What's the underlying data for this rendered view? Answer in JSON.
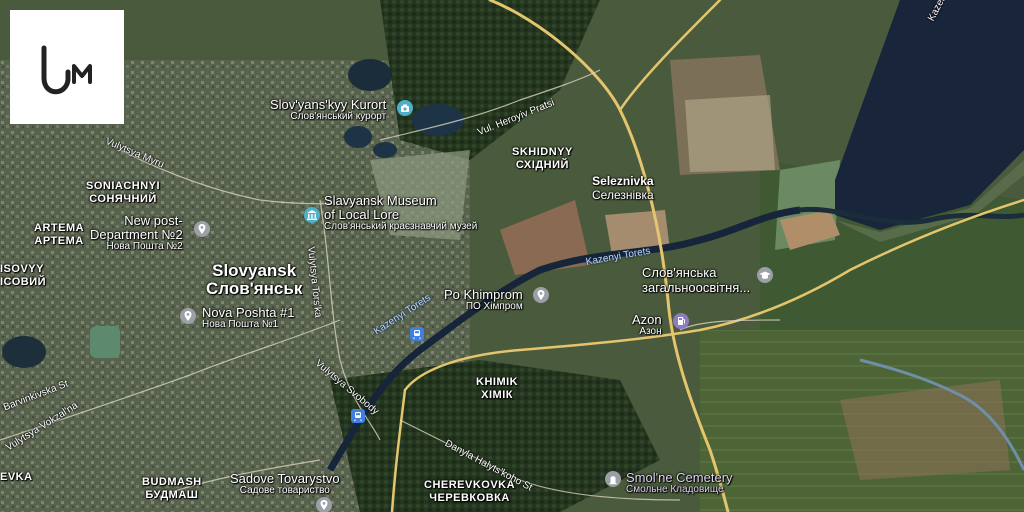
{
  "logo": {
    "glyph": "Um"
  },
  "colors": {
    "road": "#e4c56e",
    "water": "#18253a",
    "pin_gray": "#9aa0a6",
    "pin_blue": "#4db0c9",
    "pin_purple": "#8e7cc3"
  },
  "districts": {
    "soniachnyi": {
      "lat": "SONIACHNYI",
      "cyr": "СОНЯЧНИЙ"
    },
    "artema": {
      "lat": "ARTEMA",
      "cyr": "АРТЕМА"
    },
    "lisovyy": {
      "lat": "ISOVYY",
      "cyr": "ІСОВИЙ"
    },
    "skhidnyy": {
      "lat": "SKHIDNYY",
      "cyr": "СХІДНИЙ"
    },
    "khimik": {
      "lat": "KHIMIK",
      "cyr": "ХІМІК"
    },
    "cherevkovka": {
      "lat": "CHEREVKOVKA",
      "cyr": "ЧЕРЕВКОВКА"
    },
    "budmash": {
      "lat": "BUDMASH",
      "cyr": "БУДМАШ"
    },
    "evka": {
      "lat": "EVKA"
    }
  },
  "city": {
    "lat": "Slovyansk",
    "cyr": "Слов'янськ"
  },
  "village": {
    "lat": "Seleznivka",
    "cyr": "Селезнівка"
  },
  "pois": {
    "kurort": {
      "lat": "Slov'yans'kyy Kurort",
      "cyr": "Слов'янський курорт",
      "icon": "camera-icon"
    },
    "museum": {
      "lat1": "Slavyansk Museum",
      "lat2": "of Local Lore",
      "cyr": "Слов'янський краєзнавчий музей",
      "icon": "museum-icon"
    },
    "post2": {
      "lat1": "New post-",
      "lat2": "Department №2",
      "cyr": "Нова Пошта №2",
      "icon": "pin-icon"
    },
    "post1": {
      "lat": "Nova Poshta #1",
      "cyr": "Нова Пошта №1",
      "icon": "pin-icon"
    },
    "khimprom": {
      "lat": "Po Khimprom",
      "cyr": "ПО Хімпром",
      "icon": "pin-icon"
    },
    "school": {
      "lat": "Слов'янська",
      "cyr": "загальноосвітня...",
      "icon": "school-icon"
    },
    "azon": {
      "lat": "Azon",
      "cyr": "Азон",
      "icon": "fuel-icon"
    },
    "cemetery": {
      "lat": "Smol'ne Cemetery",
      "cyr": "Смольне Кладовище",
      "icon": "cemetery-icon"
    },
    "sadove": {
      "lat": "Sadove Tovarystvo",
      "cyr": "Садове товариство",
      "icon": "pin-icon"
    }
  },
  "streets": {
    "myru": "Vulytsya Myru",
    "heroyiv": "Vul. Heroyiv Pratsi",
    "torska": "Vulytsya Tors'ka",
    "barvinkivska": "Barvinkivska St",
    "vokzalna": "Vulytsya Vokzal'na",
    "svobody": "Vulytsya Svobody",
    "danyla": "Danyla Halyts'koho St",
    "kazenyi_top": "Kazeni"
  },
  "rivers": {
    "kazenyi1": "Kazenyi Torets",
    "kazenyi2": "Kazenyi Torets"
  }
}
